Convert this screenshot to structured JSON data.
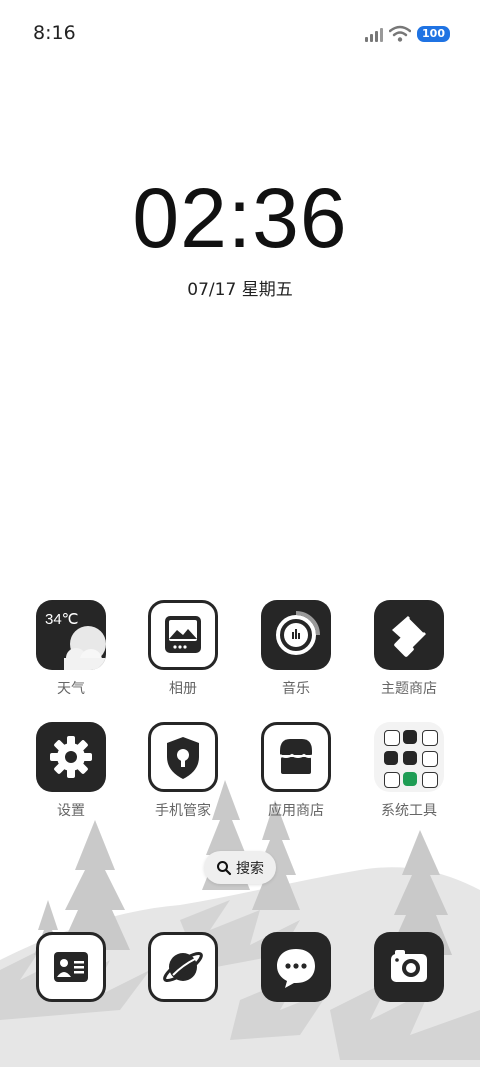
{
  "status_bar": {
    "time": "8:16",
    "battery": "100",
    "icons": [
      "signal-icon",
      "wifi-icon",
      "battery-icon"
    ]
  },
  "clock": {
    "time": "02:36",
    "date": "07/17 星期五"
  },
  "weather": {
    "temp": "34℃"
  },
  "apps": [
    {
      "label": "天气",
      "icon": "weather-icon"
    },
    {
      "label": "相册",
      "icon": "gallery-icon"
    },
    {
      "label": "音乐",
      "icon": "music-icon"
    },
    {
      "label": "主题商店",
      "icon": "theme-brush-icon"
    },
    {
      "label": "设置",
      "icon": "gear-icon"
    },
    {
      "label": "手机管家",
      "icon": "security-shield-icon"
    },
    {
      "label": "应用商店",
      "icon": "app-store-icon"
    },
    {
      "label": "系统工具",
      "icon": "folder-icon"
    }
  ],
  "search": {
    "label": "搜索"
  },
  "dock": [
    {
      "icon": "contacts-icon"
    },
    {
      "icon": "browser-planet-icon"
    },
    {
      "icon": "messages-icon"
    },
    {
      "icon": "camera-icon"
    }
  ],
  "colors": {
    "icon_dark": "#262626",
    "label": "#666666",
    "battery": "#1f73e3"
  }
}
